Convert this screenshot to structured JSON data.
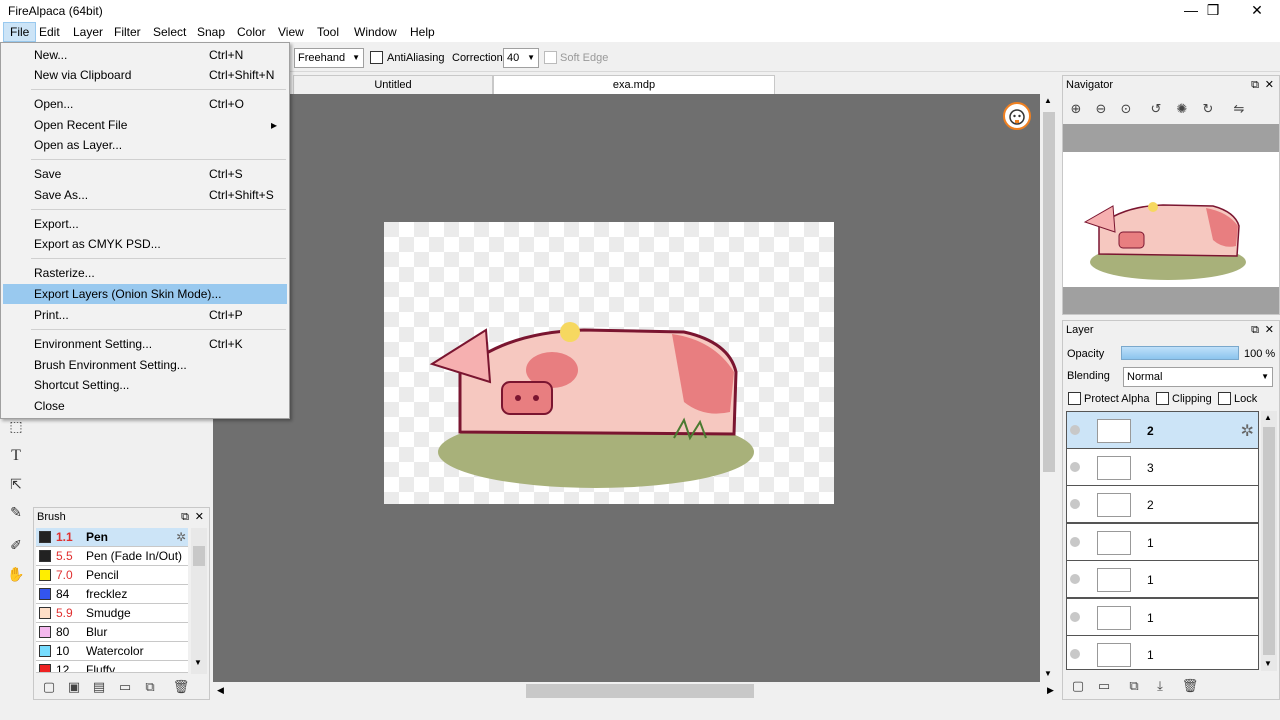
{
  "window": {
    "title": "FireAlpaca (64bit)",
    "minimize": "—",
    "maximize": "❒",
    "close": "✕"
  },
  "menubar": [
    "File",
    "Edit",
    "Layer",
    "Filter",
    "Select",
    "Snap",
    "Color",
    "View",
    "Tool",
    "Window",
    "Help"
  ],
  "toolbar": {
    "stroke_mode": "Freehand",
    "antialiasing_label": "AntiAliasing",
    "correction_label": "Correction",
    "correction_value": "40",
    "soft_edge_label": "Soft Edge"
  },
  "tabs": [
    "Untitled",
    "exa.mdp"
  ],
  "file_menu": [
    {
      "label": "New...",
      "shortcut": "Ctrl+N"
    },
    {
      "label": "New via Clipboard",
      "shortcut": "Ctrl+Shift+N"
    },
    {
      "label": "Open...",
      "shortcut": "Ctrl+O"
    },
    {
      "label": "Open Recent File",
      "shortcut": "▸"
    },
    {
      "label": "Open as Layer...",
      "shortcut": ""
    },
    {
      "label": "Save",
      "shortcut": "Ctrl+S"
    },
    {
      "label": "Save As...",
      "shortcut": "Ctrl+Shift+S"
    },
    {
      "label": "Export...",
      "shortcut": ""
    },
    {
      "label": "Export as CMYK PSD...",
      "shortcut": ""
    },
    {
      "label": "Rasterize...",
      "shortcut": ""
    },
    {
      "label": "Export Layers (Onion Skin Mode)...",
      "shortcut": ""
    },
    {
      "label": "Print...",
      "shortcut": "Ctrl+P"
    },
    {
      "label": "Environment Setting...",
      "shortcut": "Ctrl+K"
    },
    {
      "label": "Brush Environment Setting...",
      "shortcut": ""
    },
    {
      "label": "Shortcut Setting...",
      "shortcut": ""
    },
    {
      "label": "Close",
      "shortcut": ""
    }
  ],
  "brush_panel": {
    "title": "Brush",
    "items": [
      {
        "size": "1.1",
        "name": "Pen",
        "color": "#222222"
      },
      {
        "size": "5.5",
        "name": "Pen (Fade In/Out)",
        "color": "#222222"
      },
      {
        "size": "7.0",
        "name": "Pencil",
        "color": "#ffee00"
      },
      {
        "size": "84",
        "name": "frecklez",
        "color": "#3355ee"
      },
      {
        "size": "5.9",
        "name": "Smudge",
        "color": "#ffdfc8"
      },
      {
        "size": "80",
        "name": "Blur",
        "color": "#f4b8ee"
      },
      {
        "size": "10",
        "name": "Watercolor",
        "color": "#77ddff"
      },
      {
        "size": "12",
        "name": "Fluffy",
        "color": "#ee2222"
      }
    ]
  },
  "navigator": {
    "title": "Navigator"
  },
  "layer_panel": {
    "title": "Layer",
    "opacity_label": "Opacity",
    "opacity_value": "100 %",
    "opacity": 1.0,
    "blending_label": "Blending",
    "blending_value": "Normal",
    "protect_alpha": "Protect Alpha",
    "clipping": "Clipping",
    "lock": "Lock",
    "layers": [
      "2",
      "3",
      "2",
      "1",
      "1",
      "1",
      "1"
    ]
  }
}
